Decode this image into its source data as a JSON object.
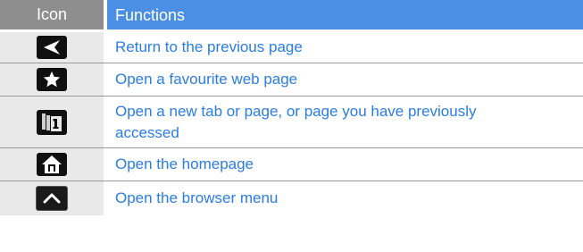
{
  "header": {
    "col_icon": "Icon",
    "col_functions": "Functions"
  },
  "rows": [
    {
      "icon": "back-arrow-icon",
      "text": "Return to the previous page"
    },
    {
      "icon": "star-icon",
      "text": "Open a favourite web page"
    },
    {
      "icon": "multiple-windows-icon",
      "text": "Open a new tab or page, or page you have previously accessed"
    },
    {
      "icon": "home-icon",
      "text": "Open the homepage"
    },
    {
      "icon": "menu-up-icon",
      "text": "Open the browser menu"
    }
  ],
  "colors": {
    "header_icon_bg": "#8e8e8e",
    "header_functions_bg": "#4a8fe3",
    "icon_cell_bg": "#e9e9e9",
    "text_color": "#2a7de1"
  }
}
